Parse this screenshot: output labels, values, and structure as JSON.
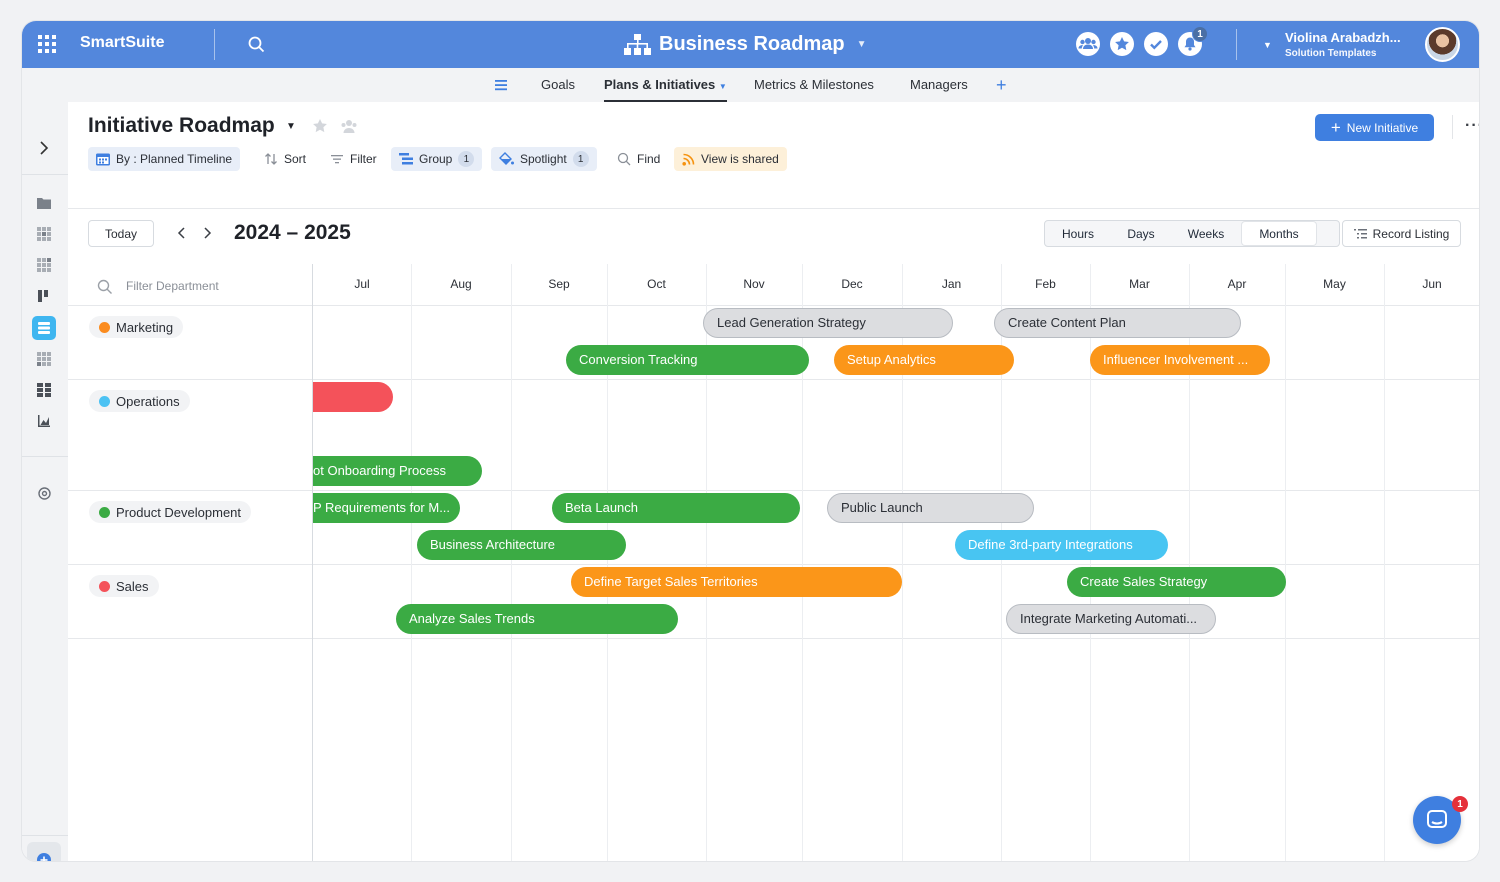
{
  "app": {
    "name": "SmartSuite",
    "title": "Business Roadmap"
  },
  "user": {
    "name": "Violina Arabadzh...",
    "subtitle": "Solution Templates",
    "notification_count": "1"
  },
  "tabs": [
    {
      "label": "Goals"
    },
    {
      "label": "Plans & Initiatives"
    },
    {
      "label": "Metrics & Milestones"
    },
    {
      "label": "Managers"
    }
  ],
  "view": {
    "title": "Initiative Roadmap",
    "new_button": "New Initiative",
    "toolbar": {
      "by": "By : Planned Timeline",
      "sort": "Sort",
      "filter": "Filter",
      "group": "Group",
      "group_count": "1",
      "spotlight": "Spotlight",
      "spotlight_count": "1",
      "find": "Find",
      "shared": "View is shared"
    }
  },
  "timeline": {
    "today": "Today",
    "range": "2024 – 2025",
    "scales": [
      "Hours",
      "Days",
      "Weeks",
      "Months"
    ],
    "active_scale": "Months",
    "record_listing": "Record Listing",
    "filter_placeholder": "Filter Department",
    "months": [
      "Jul",
      "Aug",
      "Sep",
      "Oct",
      "Nov",
      "Dec",
      "Jan",
      "Feb",
      "Mar",
      "Apr",
      "May",
      "Jun"
    ]
  },
  "groups": [
    {
      "label": "Marketing",
      "color": "#fb8c1f"
    },
    {
      "label": "Operations",
      "color": "#4cc2f3"
    },
    {
      "label": "Product Development",
      "color": "#3bab44"
    },
    {
      "label": "Sales",
      "color": "#f4525a"
    }
  ],
  "bars": [
    {
      "label": "Lead Generation Strategy",
      "style": "gray"
    },
    {
      "label": "Create Content Plan",
      "style": "gray"
    },
    {
      "label": "Conversion Tracking",
      "style": "green"
    },
    {
      "label": "Setup Analytics",
      "style": "orange"
    },
    {
      "label": "Influencer Involvement ...",
      "style": "orange"
    },
    {
      "label": "",
      "style": "red"
    },
    {
      "label": "ot Onboarding Process",
      "style": "green"
    },
    {
      "label": "P Requirements for M...",
      "style": "green"
    },
    {
      "label": "Beta Launch",
      "style": "green"
    },
    {
      "label": "Public Launch",
      "style": "gray"
    },
    {
      "label": "Business Architecture",
      "style": "green"
    },
    {
      "label": "Define 3rd-party Integrations",
      "style": "blue"
    },
    {
      "label": "Define Target Sales Territories",
      "style": "orange"
    },
    {
      "label": "Create Sales Strategy",
      "style": "green"
    },
    {
      "label": "Analyze Sales Trends",
      "style": "green"
    },
    {
      "label": "Integrate Marketing Automati...",
      "style": "gray"
    }
  ],
  "chat_badge": "1",
  "colors": {
    "header": "#5387dc",
    "accent": "#3f7fe0"
  }
}
